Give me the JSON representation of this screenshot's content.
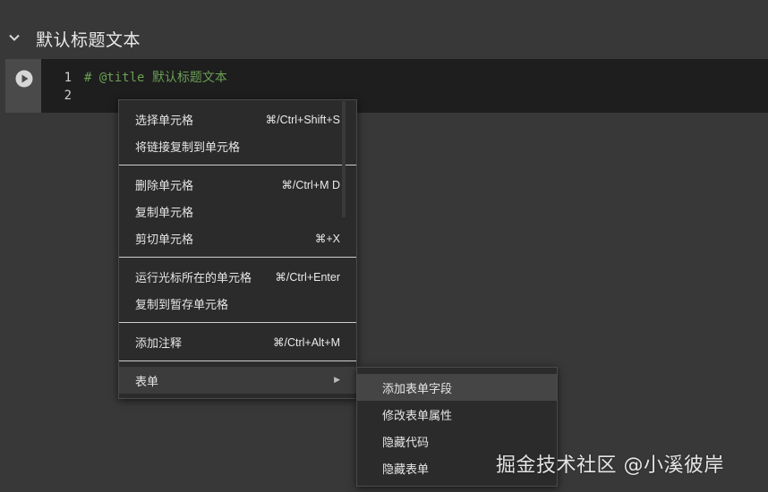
{
  "section": {
    "title": "默认标题文本",
    "collapse_icon": "chevron-down-icon"
  },
  "cell": {
    "run_icon": "play-circle-icon",
    "line_numbers": [
      "1",
      "2"
    ],
    "code_lines": [
      "# @title 默认标题文本",
      ""
    ]
  },
  "context_menu": {
    "groups": [
      [
        {
          "label": "选择单元格",
          "shortcut": "⌘/Ctrl+Shift+S"
        },
        {
          "label": "将链接复制到单元格",
          "shortcut": ""
        }
      ],
      [
        {
          "label": "删除单元格",
          "shortcut": "⌘/Ctrl+M D"
        },
        {
          "label": "复制单元格",
          "shortcut": ""
        },
        {
          "label": "剪切单元格",
          "shortcut": "⌘+X"
        }
      ],
      [
        {
          "label": "运行光标所在的单元格",
          "shortcut": "⌘/Ctrl+Enter"
        },
        {
          "label": "复制到暂存单元格",
          "shortcut": ""
        }
      ],
      [
        {
          "label": "添加注释",
          "shortcut": "⌘/Ctrl+Alt+M"
        }
      ],
      [
        {
          "label": "表单",
          "shortcut": "▶"
        }
      ]
    ]
  },
  "form_submenu": {
    "items": [
      "添加表单字段",
      "修改表单属性",
      "隐藏代码",
      "隐藏表单"
    ],
    "hovered_index": 0
  },
  "watermark": {
    "text": "掘金技术社区 @小溪彼岸"
  },
  "colors": {
    "background": "#383838",
    "cell_background": "#1e1e1e",
    "comment_green": "#6a9e55",
    "menu_background": "#2b2b2b"
  }
}
